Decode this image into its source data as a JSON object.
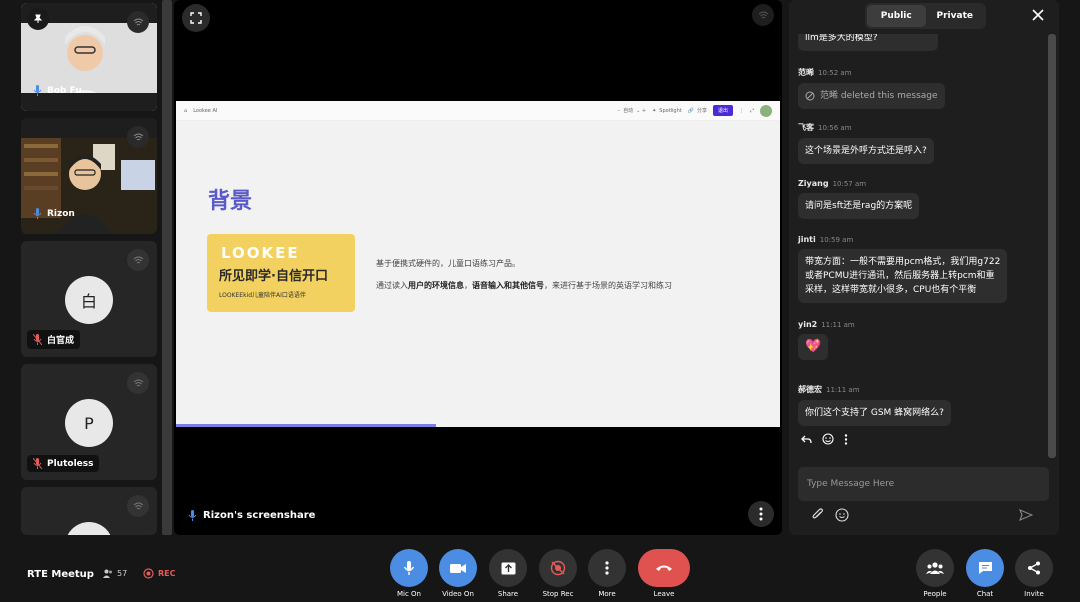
{
  "participants": [
    {
      "name": "Bob Fu",
      "type": "video"
    },
    {
      "name": "Rizon",
      "type": "video"
    },
    {
      "name": "白官成",
      "initial": "白",
      "type": "avatar"
    },
    {
      "name": "Plutoless",
      "initial": "P",
      "type": "avatar"
    }
  ],
  "stage": {
    "caption": "Rizon's screenshare",
    "slide": {
      "toolbar": {
        "breadcrumb": "Lookee AI",
        "zoom": "自动",
        "spotlight": "Spotlight",
        "share": "分享",
        "exit": "退出"
      },
      "title": "背景",
      "logo": {
        "brand": "LOOKEE",
        "slogan": "所见即学·自信开口",
        "subtitle": "LOOKEEkid儿童陪伴AI口语语伴"
      },
      "line1": "基于便携式硬件的，儿童口语练习产品。",
      "line2_prefix": "通过读入",
      "line2_bold1": "用户的环境信息",
      "line2_mid": "，",
      "line2_bold2": "语音输入和其他信号",
      "line2_suffix": "，来进行基于场景的英语学习和练习"
    }
  },
  "chat": {
    "tabs": [
      {
        "label": "Public",
        "active": true
      },
      {
        "label": "Private",
        "active": false
      }
    ],
    "messages": [
      {
        "sender": "",
        "time": "",
        "text": "llm是多大的模型?"
      },
      {
        "sender": "范晞",
        "time": "10:52 am",
        "text": "范晞 deleted this message",
        "deleted": true
      },
      {
        "sender": "飞客",
        "time": "10:56 am",
        "text": "这个场景是外呼方式还是呼入?"
      },
      {
        "sender": "Ziyang",
        "time": "10:57 am",
        "text": "请问是sft还是rag的方案呢"
      },
      {
        "sender": "jinti",
        "time": "10:59 am",
        "text_lines": [
          "带宽方面：一般不需要用pcm格式，我们用g722",
          "或者PCMU进行通讯，然后服务器上转pcm和重",
          "采样，这样带宽就小很多，CPU也有个平衡"
        ]
      },
      {
        "sender": "yin2",
        "time": "11:11 am",
        "text": "💖"
      },
      {
        "sender": "郝德宏",
        "time": "11:11 am",
        "text": "你们这个支持了 GSM 蜂窝网络么?"
      }
    ],
    "input_placeholder": "Type Message Here"
  },
  "bottom": {
    "meeting_name": "RTE Meetup",
    "participant_count": "57",
    "rec_label": "REC",
    "controls": [
      {
        "label": "Mic On"
      },
      {
        "label": "Video On"
      },
      {
        "label": "Share"
      },
      {
        "label": "Stop Rec"
      },
      {
        "label": "More"
      },
      {
        "label": "Leave"
      }
    ],
    "right_controls": [
      {
        "label": "People"
      },
      {
        "label": "Chat"
      },
      {
        "label": "Invite"
      }
    ]
  },
  "colors": {
    "accent_blue": "#4c8de4",
    "leave_red": "#e0524f",
    "slide_title": "#5a5bc8",
    "logo_yellow": "#f2d160"
  }
}
